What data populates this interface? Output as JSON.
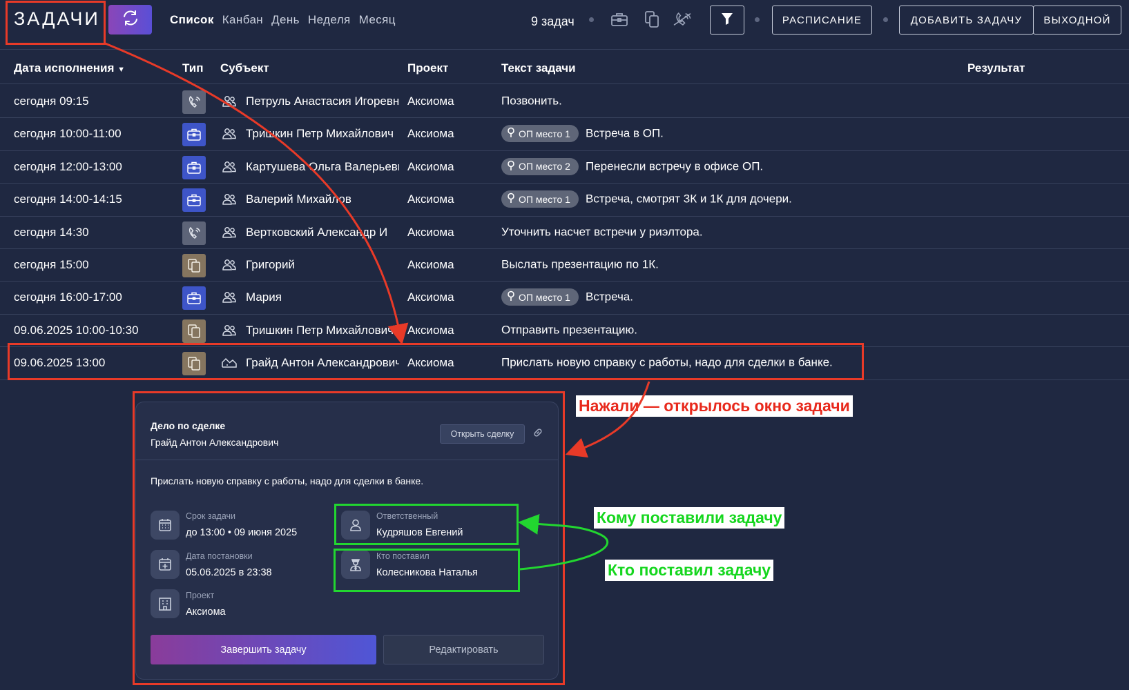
{
  "header": {
    "title": "ЗАДАЧИ",
    "views": [
      "Список",
      "Канбан",
      "День",
      "Неделя",
      "Месяц"
    ],
    "task_count": "9 задач",
    "schedule_label": "РАСПИСАНИЕ",
    "add_task_label": "ДОБАВИТЬ ЗАДАЧУ",
    "day_off_label": "ВЫХОДНОЙ"
  },
  "table": {
    "columns": {
      "due": "Дата исполнения",
      "type": "Тип",
      "subject": "Субъект",
      "project": "Проект",
      "text": "Текст задачи",
      "result": "Результат"
    },
    "rows": [
      {
        "due": "сегодня 09:15",
        "type": "call",
        "subject": "Петруль Анастасия Игоревна",
        "project": "Аксиома",
        "badge": "",
        "text": "Позвонить."
      },
      {
        "due": "сегодня 10:00-11:00",
        "type": "meeting",
        "subject": "Тришкин Петр Михайлович",
        "project": "Аксиома",
        "badge": "ОП место 1",
        "text": "Встреча в ОП."
      },
      {
        "due": "сегодня 12:00-13:00",
        "type": "meeting",
        "subject": "Картушева Ольга Валерьевна",
        "project": "Аксиома",
        "badge": "ОП место 2",
        "text": "Перенесли встречу в офисе ОП."
      },
      {
        "due": "сегодня 14:00-14:15",
        "type": "meeting",
        "subject": "Валерий Михайлов",
        "project": "Аксиома",
        "badge": "ОП место 1",
        "text": "Встреча, смотрят 3К и 1К для дочери."
      },
      {
        "due": "сегодня 14:30",
        "type": "call",
        "subject": "Вертковский Александр И",
        "project": "Аксиома",
        "badge": "",
        "text": "Уточнить насчет встречи у риэлтора."
      },
      {
        "due": "сегодня 15:00",
        "type": "document",
        "subject": "Григорий",
        "project": "Аксиома",
        "badge": "",
        "text": "Выслать презентацию по 1К."
      },
      {
        "due": "сегодня 16:00-17:00",
        "type": "meeting",
        "subject": "Мария",
        "project": "Аксиома",
        "badge": "ОП место 1",
        "text": "Встреча."
      },
      {
        "due": "09.06.2025 10:00-10:30",
        "type": "document",
        "subject": "Тришкин Петр Михайлович",
        "project": "Аксиома",
        "badge": "",
        "text": "Отправить презентацию."
      },
      {
        "due": "09.06.2025 13:00",
        "type": "document",
        "subject": "Грайд Антон Александрович",
        "project": "Аксиома",
        "badge": "",
        "text": "Прислать новую справку с работы, надо для сделки в банке."
      }
    ]
  },
  "task_card": {
    "kind": "Дело по сделке",
    "subject": "Грайд Антон Александрович",
    "open_deal_label": "Открыть сделку",
    "text": "Прислать новую справку с работы, надо для сделки в банке.",
    "deadline_label": "Срок задачи",
    "deadline_value": "до 13:00 • 09 июня 2025",
    "created_label": "Дата постановки",
    "created_value": "05.06.2025 в 23:38",
    "project_label": "Проект",
    "project_value": "Аксиома",
    "responsible_label": "Ответственный",
    "responsible_value": "Кудряшов Евгений",
    "author_label": "Кто поставил",
    "author_value": "Колесникова Наталья",
    "finish_label": "Завершить задачу",
    "edit_label": "Редактировать"
  },
  "annotations": {
    "opened": "Нажали — открылось окно задачи",
    "assignee": "Кому поставили задачу",
    "author": "Кто поставил задачу"
  },
  "colors": {
    "background": "#1f2841",
    "annotation_red": "#e83a28",
    "annotation_green": "#22d630",
    "meeting_type": "#3e55c8",
    "call_type": "#5d6478",
    "document_type": "#85755f"
  }
}
